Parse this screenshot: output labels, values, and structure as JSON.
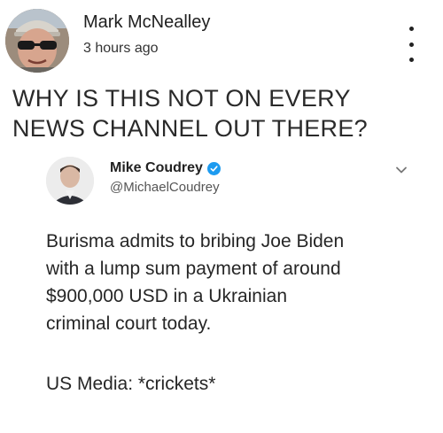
{
  "post": {
    "author_name": "Mark McNealley",
    "timestamp": "3 hours ago",
    "more_icon": "vertical-ellipsis-icon",
    "headline": "WHY IS THIS NOT ON EVERY\nNEWS CHANNEL OUT THERE?"
  },
  "tweet": {
    "name": "Mike Coudrey",
    "handle": "@MichaelCoudrey",
    "verified_icon": "verified-badge-icon",
    "chevron_icon": "chevron-down-icon",
    "body_lines": [
      "Burisma admits to bribing Joe Biden",
      "with a lump sum payment of around",
      "$900,000 USD in a Ukrainian",
      "criminal court today."
    ],
    "footnote": "US Media: *crickets*"
  },
  "colors": {
    "verified_blue": "#1d9bf0",
    "text_dark": "#262626",
    "text_muted": "#555555"
  }
}
